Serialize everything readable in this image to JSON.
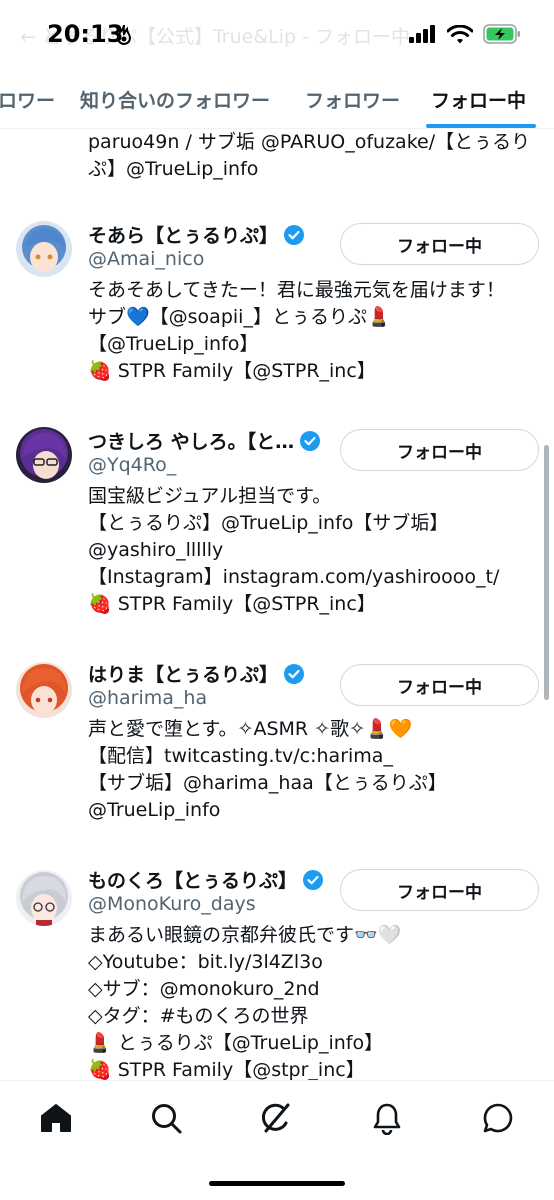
{
  "status_bar": {
    "time": "20:13",
    "faded_title": "← とぅるりぷ【公式】True&Lip - フォロー中"
  },
  "tabs": [
    {
      "label": "ロワー"
    },
    {
      "label": "知り合いのフォロワー"
    },
    {
      "label": "フォロワー"
    },
    {
      "label": "フォロー中",
      "active": true
    }
  ],
  "feed": {
    "partial_bio": [
      "paruo49n / サブ垢 @PARUO_ofuzake/【とぅるり",
      "ぷ】@TrueLip_info"
    ],
    "users": [
      {
        "name": "そあら【とぅるりぷ】",
        "handle": "@Amai_nico",
        "verified": true,
        "button": "フォロー中",
        "bio": [
          "そあそあしてきたー！君に最強元気を届けます！",
          "サブ💙【@soapii_】とぅるりぷ💄",
          "【@TrueLip_info】",
          "🍓 STPR Family【@STPR_inc】"
        ]
      },
      {
        "name": "つきしろ やしろ。【と…",
        "handle": "@Yq4Ro_",
        "verified": true,
        "button": "フォロー中",
        "bio": [
          "国宝級ビジュアル担当です。",
          "【とぅるりぷ】@TrueLip_info【サブ垢】",
          "@yashiro_llllly",
          "【Instagram】instagram.com/yashiroooo_t/",
          "🍓 STPR Family【@STPR_inc】"
        ]
      },
      {
        "name": "はりま【とぅるりぷ】",
        "handle": "@harima_ha",
        "verified": true,
        "button": "フォロー中",
        "bio": [
          "声と愛で堕とす。✧ASMR ✧歌✧💄🧡",
          "【配信】twitcasting.tv/c:harima_",
          "【サブ垢】@harima_haa【とぅるりぷ】",
          "@TrueLip_info"
        ]
      },
      {
        "name": "ものくろ【とぅるりぷ】",
        "handle": "@MonoKuro_days",
        "verified": true,
        "button": "フォロー中",
        "bio": [
          "まあるい眼鏡の京都弁彼氏です👓🤍",
          "◇Youtube：bit.ly/3l4Zl3o",
          "◇サブ：@monokuro_2nd",
          "◇タグ：#ものくろの世界",
          "💄 とぅるりぷ【@TrueLip_info】",
          "🍓 STPR Family【@stpr_inc】"
        ]
      }
    ]
  },
  "bottom_nav": [
    {
      "icon": "home-icon"
    },
    {
      "icon": "search-icon"
    },
    {
      "icon": "grok-icon"
    },
    {
      "icon": "bell-icon"
    },
    {
      "icon": "messages-icon"
    }
  ],
  "colors": {
    "accent": "#1d9bf0",
    "verified": "#1d9bf0",
    "text": "#0f1419",
    "secondary": "#536471"
  }
}
